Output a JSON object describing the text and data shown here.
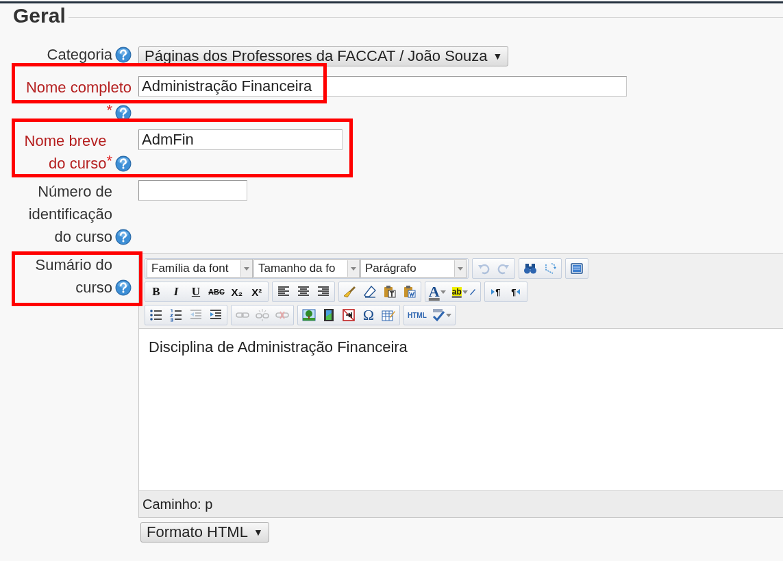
{
  "fieldset": {
    "legend": "Geral"
  },
  "fields": [
    {
      "kind": "select",
      "label": "Categoria",
      "required": false,
      "help": true,
      "value": "Páginas dos Professores da FACCAT / João Souza",
      "arrow": "▼",
      "highlighted": false
    },
    {
      "kind": "text",
      "label": "Nome completo",
      "required": true,
      "required_mark": "*",
      "help": true,
      "value": "Administração Financeira",
      "highlighted": true
    },
    {
      "kind": "text",
      "label": "Nome breve do curso",
      "required": true,
      "required_mark": "*",
      "help": true,
      "value": "AdmFin",
      "highlighted": true
    },
    {
      "kind": "text",
      "label": "Número de identificação do curso",
      "required": false,
      "help": true,
      "highlighted": false
    },
    {
      "kind": "editor",
      "label": "Sumário do curso",
      "required": false,
      "help": true,
      "highlighted": true
    }
  ],
  "editor": {
    "toolbar": [
      [
        [
          {
            "kind": "dropdown",
            "label": "Família da font"
          },
          {
            "kind": "dropdown",
            "label": "Tamanho da fo"
          },
          {
            "kind": "dropdown",
            "label": "Parágrafo"
          }
        ],
        [
          {
            "kind": "undo",
            "disabled": true
          },
          {
            "kind": "redo",
            "disabled": true
          }
        ],
        [
          {
            "kind": "find",
            "disabled": false
          },
          {
            "kind": "replace",
            "disabled": false
          }
        ],
        [
          {
            "kind": "fullscreen",
            "disabled": false
          }
        ]
      ],
      [
        [
          {
            "kind": "bold",
            "label": "B",
            "disabled": false
          },
          {
            "kind": "italic",
            "label": "I",
            "disabled": false
          },
          {
            "kind": "underline",
            "label": "U",
            "disabled": false
          },
          {
            "kind": "strike",
            "label": "ABC",
            "disabled": false
          },
          {
            "kind": "sub",
            "label": "X₂",
            "disabled": false
          },
          {
            "kind": "sup",
            "label": "X²",
            "disabled": false
          }
        ],
        [
          {
            "kind": "alignleft",
            "disabled": false
          },
          {
            "kind": "aligncenter",
            "disabled": false
          },
          {
            "kind": "alignright",
            "disabled": false
          }
        ],
        [
          {
            "kind": "cleanup",
            "disabled": false
          },
          {
            "kind": "eraser",
            "disabled": false
          },
          {
            "kind": "pastetext",
            "disabled": false
          },
          {
            "kind": "pasteword",
            "disabled": false
          }
        ],
        [
          {
            "kind": "forecolor",
            "label": "A",
            "disabled": false
          },
          {
            "kind": "hilite",
            "label": "ab",
            "disabled": false
          }
        ],
        [
          {
            "kind": "ltr",
            "label": "¶",
            "disabled": false
          },
          {
            "kind": "rtl",
            "label": "¶",
            "disabled": false
          }
        ]
      ],
      [
        [
          {
            "kind": "bullist",
            "disabled": false
          },
          {
            "kind": "numlist",
            "disabled": false
          },
          {
            "kind": "outdent",
            "disabled": true
          },
          {
            "kind": "indent",
            "disabled": false
          }
        ],
        [
          {
            "kind": "link",
            "disabled": true
          },
          {
            "kind": "unlink",
            "disabled": true
          },
          {
            "kind": "nolink",
            "disabled": true
          }
        ],
        [
          {
            "kind": "image",
            "disabled": false
          },
          {
            "kind": "media",
            "disabled": false
          },
          {
            "kind": "nbsp",
            "disabled": false
          },
          {
            "kind": "charmap",
            "label": "Ω",
            "disabled": false
          },
          {
            "kind": "table",
            "disabled": false
          }
        ],
        [
          {
            "kind": "code",
            "label": "HTML",
            "disabled": false
          },
          {
            "kind": "spell",
            "disabled": false
          }
        ]
      ]
    ],
    "content": "Disciplina de Administração Financeira",
    "path": "Caminho: p"
  },
  "format_select": {
    "value": "Formato HTML",
    "arrow": "▼"
  }
}
